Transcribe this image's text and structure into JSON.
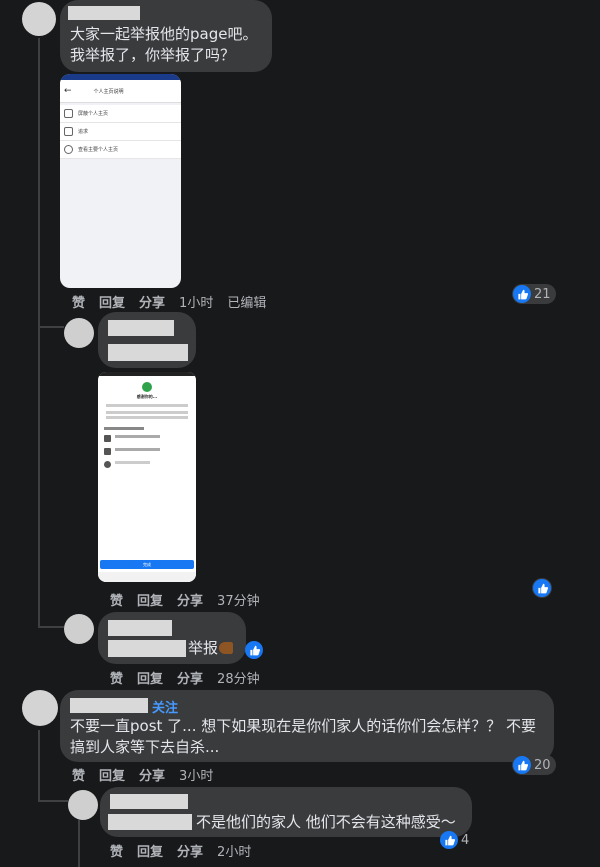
{
  "comment1": {
    "text_line1": "大家一起举报他的page吧。",
    "text_line2": "我举报了，你举报了吗？",
    "screenshot": {
      "header_title": "个人主页说明",
      "menu_items": [
        "屏蔽个人主页",
        "追求",
        "查看主要个人主页"
      ]
    },
    "actions": {
      "like": "赞",
      "reply": "回复",
      "share": "分享",
      "time": "1小时",
      "edited": "已编辑"
    },
    "reaction_count": "21"
  },
  "reply1": {
    "screenshot": {
      "title": "感谢你的...",
      "button": "完成"
    },
    "actions": {
      "like": "赞",
      "reply": "回复",
      "share": "分享",
      "time": "37分钟"
    }
  },
  "reply2": {
    "text": "举报",
    "actions": {
      "like": "赞",
      "reply": "回复",
      "share": "分享",
      "time": "28分钟"
    }
  },
  "comment2": {
    "follow": "关注",
    "text_line1": "不要一直post 了... 想下如果现在是你们家人的话你们会怎样？？ 不要",
    "text_line2": "搞到人家等下去自杀...",
    "actions": {
      "like": "赞",
      "reply": "回复",
      "share": "分享",
      "time": "3小时"
    },
    "reaction_count": "20"
  },
  "reply3": {
    "text": "不是他们的家人 他们不会有这种感受～",
    "actions": {
      "like": "赞",
      "reply": "回复",
      "share": "分享",
      "time": "2小时"
    },
    "reaction_count": "4"
  },
  "colors": {
    "background": "#18191a",
    "bubble": "#3a3b3c",
    "like": "#1877f2",
    "link": "#4599ff"
  },
  "icons": [
    "like-icon",
    "back-arrow-icon",
    "flex-emoji-icon"
  ]
}
